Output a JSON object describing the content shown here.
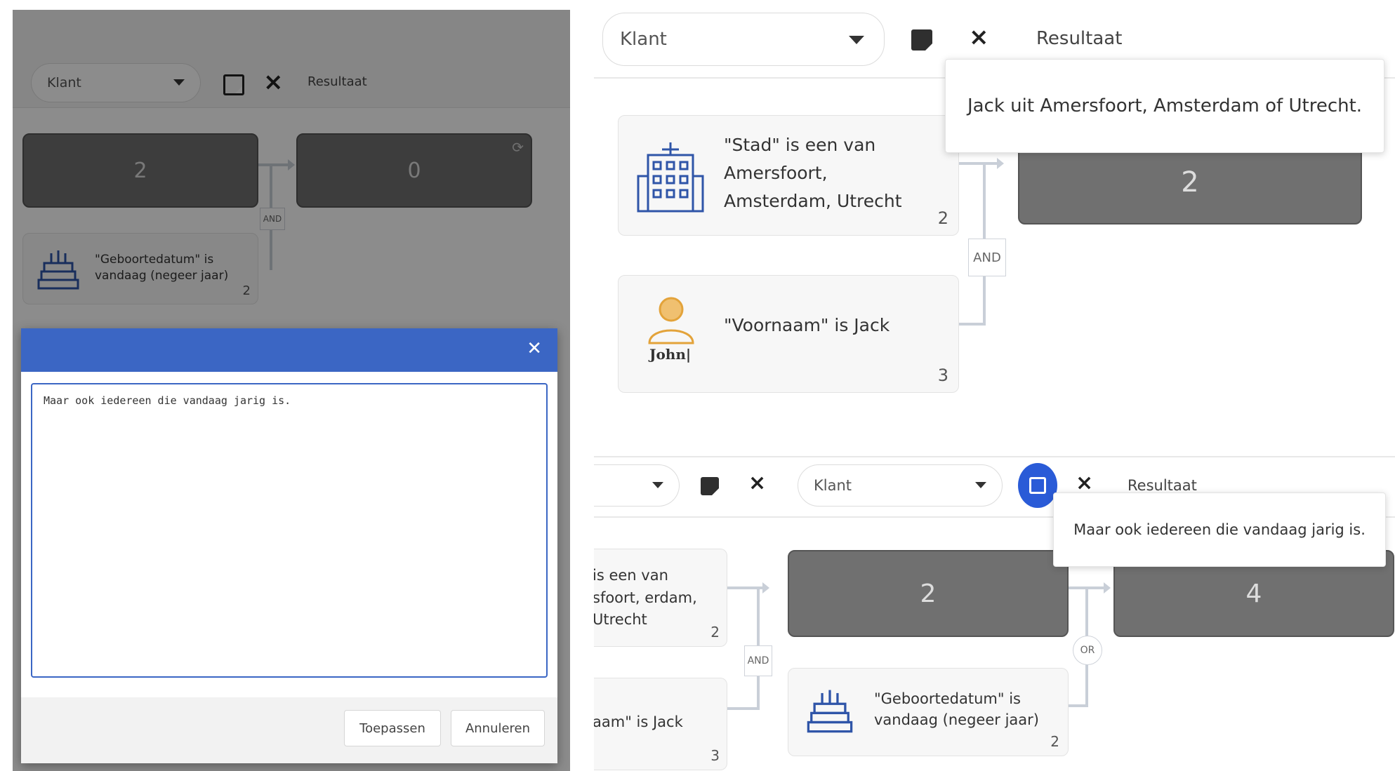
{
  "left_panel": {
    "entity_select": "Klant",
    "result_label": "Resultaat",
    "nodes": [
      {
        "value": "2"
      },
      {
        "value": "0"
      }
    ],
    "and_tag": "AND",
    "condition": {
      "text": "\"Geboortedatum\" is vandaag (negeer jaar)",
      "count": "2"
    },
    "modal": {
      "textarea_value": "Maar ook iedereen die vandaag jarig is.",
      "apply_button": "Toepassen",
      "cancel_button": "Annuleren",
      "close_icon": "close-icon",
      "header_color": "#3b66c4"
    }
  },
  "right_top": {
    "entity_select": "Klant",
    "result_label": "Resultaat",
    "tooltip": "Jack uit Amersfoort, Amsterdam of Utrecht.",
    "conditions": [
      {
        "text": "\"Stad\" is een van Amersfoort, Amsterdam, Utrecht",
        "count": "2",
        "icon": "building-icon"
      },
      {
        "text": "\"Voornaam\" is Jack",
        "count": "3",
        "icon": "person-icon",
        "icon_caption": "John|"
      }
    ],
    "and_tag": "AND",
    "result_node": "2"
  },
  "right_bottom": {
    "entity_select": "Klant",
    "result_label": "Resultaat",
    "tooltip": "Maar ook iedereen die vandaag jarig is.",
    "conditions": [
      {
        "text": "is een van sfoort, erdam, Utrecht",
        "count": "2"
      },
      {
        "text": "aam\" is Jack",
        "count": "3"
      },
      {
        "text": "\"Geboortedatum\" is vandaag (negeer jaar)",
        "count": "2",
        "icon": "cake-icon"
      }
    ],
    "and_tag": "AND",
    "or_tag": "OR",
    "nodes": [
      {
        "value": "2"
      },
      {
        "value": "4"
      }
    ]
  },
  "colors": {
    "primary_blue": "#3b66c4",
    "node_gray": "#707070",
    "accent_blue": "#2a5bd7"
  }
}
